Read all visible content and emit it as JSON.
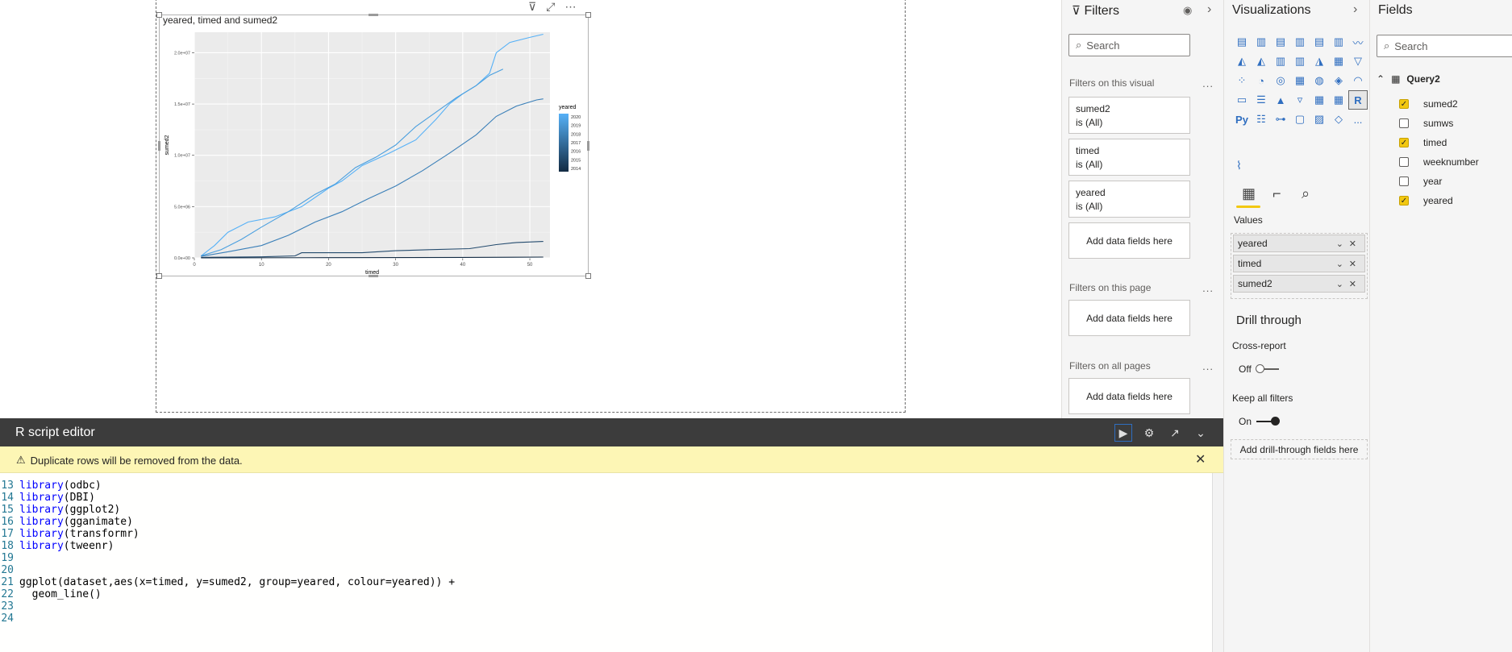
{
  "visual": {
    "title": "yeared, timed and sumed2",
    "header_icons": [
      "filter-icon",
      "focus-mode-icon",
      "more-options-icon"
    ]
  },
  "chart_data": {
    "type": "line",
    "title": "yeared, timed and sumed2",
    "xlabel": "timed",
    "ylabel": "sumed2",
    "xlim": [
      0,
      53
    ],
    "ylim": [
      0,
      22000000
    ],
    "x_ticks": [
      0,
      10,
      20,
      30,
      40,
      50
    ],
    "x_tick_labels": [
      "0",
      "10",
      "20",
      "30",
      "40",
      "50"
    ],
    "y_ticks": [
      0,
      5000000,
      10000000,
      15000000,
      20000000
    ],
    "y_tick_labels": [
      "0.0e+00",
      "5.0e+06",
      "1.0e+07",
      "1.5e+07",
      "2.0e+07"
    ],
    "grid": true,
    "legend": {
      "title": "yeared",
      "placement": "right",
      "labels": [
        "2020",
        "2019",
        "2018",
        "2017",
        "2016",
        "2015",
        "2014"
      ],
      "color_high": "#56b1f7",
      "color_low": "#132b43"
    },
    "series": [
      {
        "name": "2020",
        "color": "#56b1f7",
        "x": [
          1,
          3,
          5,
          8,
          12,
          16,
          20,
          22,
          25,
          29,
          33,
          36,
          38,
          40,
          42,
          44,
          45,
          47,
          50,
          52
        ],
        "y": [
          200000,
          1200000,
          2500000,
          3500000,
          4000000,
          5000000,
          6800000,
          7500000,
          9000000,
          10200000,
          11500000,
          13500000,
          15000000,
          16000000,
          16800000,
          18000000,
          20000000,
          21000000,
          21500000,
          21800000
        ]
      },
      {
        "name": "2019",
        "color": "#4a9fdf",
        "x": [
          1,
          4,
          7,
          10,
          14,
          18,
          21,
          24,
          27,
          30,
          33,
          36,
          39,
          42,
          44,
          46
        ],
        "y": [
          200000,
          800000,
          1800000,
          3000000,
          4500000,
          6200000,
          7200000,
          8800000,
          9800000,
          11000000,
          12800000,
          14200000,
          15600000,
          16800000,
          17800000,
          18400000
        ]
      },
      {
        "name": "2018",
        "color": "#3a7fb8",
        "x": [
          1,
          5,
          10,
          14,
          18,
          22,
          26,
          30,
          34,
          38,
          42,
          45,
          48,
          51,
          52
        ],
        "y": [
          150000,
          600000,
          1200000,
          2200000,
          3500000,
          4500000,
          5800000,
          7000000,
          8500000,
          10200000,
          12000000,
          13800000,
          14800000,
          15400000,
          15500000
        ]
      },
      {
        "name": "2015",
        "color": "#244b6e",
        "x": [
          1,
          10,
          15,
          16,
          25,
          30,
          35,
          41,
          45,
          48,
          52
        ],
        "y": [
          50000,
          100000,
          200000,
          500000,
          500000,
          700000,
          800000,
          900000,
          1300000,
          1500000,
          1600000
        ]
      },
      {
        "name": "2014",
        "color": "#132b43",
        "x": [
          1,
          20,
          40,
          52
        ],
        "y": [
          0,
          20000,
          50000,
          80000
        ]
      }
    ]
  },
  "filters": {
    "title": "Filters",
    "search_placeholder": "Search",
    "on_visual_label": "Filters on this visual",
    "cards": [
      {
        "name": "sumed2",
        "state": "is (All)"
      },
      {
        "name": "timed",
        "state": "is (All)"
      },
      {
        "name": "yeared",
        "state": "is (All)"
      }
    ],
    "add_label": "Add data fields here",
    "on_page_label": "Filters on this page",
    "all_pages_label": "Filters on all pages",
    "more": "..."
  },
  "visualizations": {
    "title": "Visualizations",
    "values_label": "Values",
    "wells": [
      "yeared",
      "timed",
      "sumed2"
    ],
    "drill_title": "Drill through",
    "cross_report_label": "Cross-report",
    "cross_report_state": "Off",
    "keep_filters_label": "Keep all filters",
    "keep_filters_state": "On",
    "add_drill_label": "Add drill-through fields here",
    "r_visual": "R",
    "py_visual": "Py",
    "more": "..."
  },
  "fields": {
    "title": "Fields",
    "search_placeholder": "Search",
    "table_name": "Query2",
    "items": [
      {
        "name": "sumed2",
        "checked": true
      },
      {
        "name": "sumws",
        "checked": false
      },
      {
        "name": "timed",
        "checked": true
      },
      {
        "name": "weeknumber",
        "checked": false
      },
      {
        "name": "year",
        "checked": false
      },
      {
        "name": "yeared",
        "checked": true
      }
    ]
  },
  "r_editor": {
    "title": "R script editor",
    "warning": "Duplicate rows will be removed from the data.",
    "lines": [
      {
        "num": "13",
        "kw": "library",
        "rest": "(odbc)"
      },
      {
        "num": "14",
        "kw": "library",
        "rest": "(DBI)"
      },
      {
        "num": "15",
        "kw": "library",
        "rest": "(ggplot2)"
      },
      {
        "num": "16",
        "kw": "library",
        "rest": "(gganimate)"
      },
      {
        "num": "17",
        "kw": "library",
        "rest": "(transformr)"
      },
      {
        "num": "18",
        "kw": "library",
        "rest": "(tweenr)"
      },
      {
        "num": "19",
        "kw": "",
        "rest": ""
      },
      {
        "num": "20",
        "kw": "",
        "rest": ""
      },
      {
        "num": "21",
        "kw": "",
        "rest": "ggplot(dataset,aes(x=timed, y=sumed2, group=yeared, colour=yeared)) +"
      },
      {
        "num": "22",
        "kw": "",
        "rest": "  geom_line()"
      },
      {
        "num": "23",
        "kw": "",
        "rest": ""
      },
      {
        "num": "24",
        "kw": "",
        "rest": ""
      }
    ]
  }
}
